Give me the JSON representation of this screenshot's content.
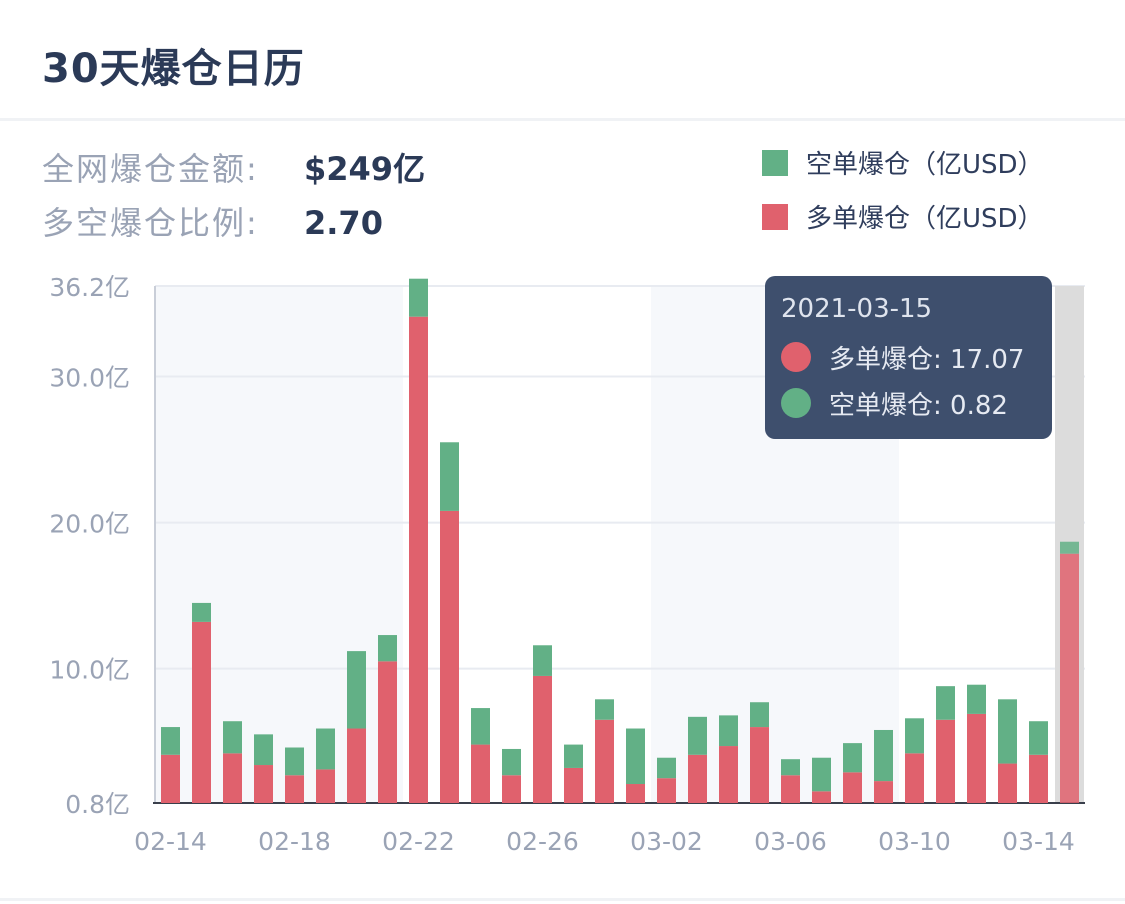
{
  "page": {
    "title": "30天爆仓日历",
    "stats": [
      {
        "label": "全网爆仓金额:",
        "value": "$249亿"
      },
      {
        "label": "多空爆仓比例:",
        "value": "2.70"
      }
    ],
    "legend": [
      {
        "label": "空单爆仓（亿USD）",
        "color": "#62b086"
      },
      {
        "label": "多单爆仓（亿USD）",
        "color": "#e0616d"
      }
    ],
    "tooltip": {
      "date": "2021-03-15",
      "rows": [
        {
          "label": "多单爆仓: 17.07",
          "color": "#e0616d"
        },
        {
          "label": "空单爆仓: 0.82",
          "color": "#62b086"
        }
      ]
    }
  },
  "chart_data": {
    "type": "bar",
    "stacked": true,
    "y_ticks": [
      "36.2亿",
      "30.0亿",
      "20.0亿",
      "10.0亿",
      "0.8亿"
    ],
    "y_tick_values": [
      36.2,
      30.0,
      20.0,
      10.0,
      0.8
    ],
    "ylim": [
      0.8,
      36.2
    ],
    "x_tick_labels": [
      "02-14",
      "02-18",
      "02-22",
      "02-26",
      "03-02",
      "03-06",
      "03-10",
      "03-14"
    ],
    "categories": [
      "02-14",
      "02-15",
      "02-16",
      "02-17",
      "02-18",
      "02-19",
      "02-20",
      "02-21",
      "02-22",
      "02-23",
      "02-24",
      "02-25",
      "02-26",
      "02-27",
      "02-28",
      "03-01",
      "03-02",
      "03-03",
      "03-04",
      "03-05",
      "03-06",
      "03-07",
      "03-08",
      "03-09",
      "03-10",
      "03-11",
      "03-12",
      "03-13",
      "03-14",
      "03-15"
    ],
    "series": [
      {
        "name": "多单爆仓（亿USD）",
        "color": "#e0616d",
        "values": [
          3.3,
          12.4,
          3.4,
          2.6,
          1.9,
          2.3,
          5.1,
          9.7,
          33.3,
          20.0,
          4.0,
          1.9,
          8.7,
          2.4,
          5.7,
          1.3,
          1.7,
          3.3,
          3.9,
          5.2,
          1.9,
          0.8,
          2.1,
          1.5,
          3.4,
          5.7,
          6.1,
          2.7,
          3.3,
          17.07
        ]
      },
      {
        "name": "空单爆仓（亿USD）",
        "color": "#62b086",
        "values": [
          1.9,
          1.3,
          2.2,
          2.1,
          1.9,
          2.8,
          5.3,
          1.8,
          2.6,
          4.7,
          2.5,
          1.8,
          2.1,
          1.6,
          1.4,
          3.8,
          1.4,
          2.6,
          2.1,
          1.7,
          1.1,
          2.3,
          2.0,
          3.5,
          2.4,
          2.3,
          2.0,
          4.4,
          2.3,
          0.82
        ]
      }
    ],
    "highlight_index": 29,
    "grid": true
  }
}
